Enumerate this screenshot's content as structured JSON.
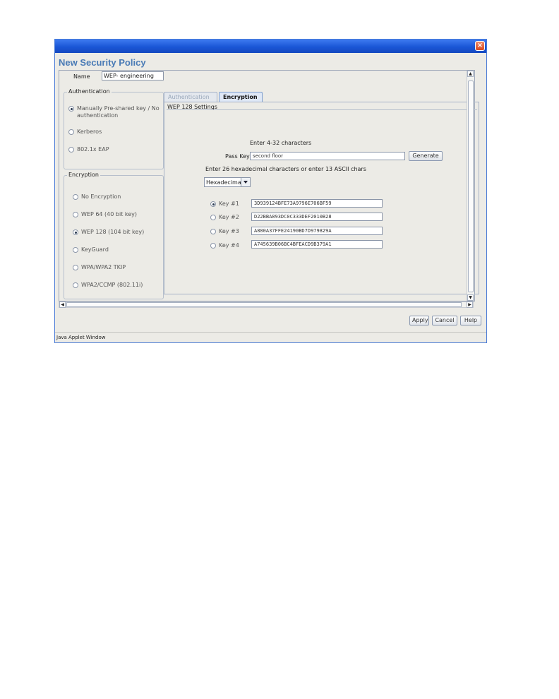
{
  "window": {
    "title": "New Security Policy",
    "status_text": "Java Applet Window"
  },
  "name_field": {
    "label": "Name",
    "value": "WEP- engineering"
  },
  "authentication": {
    "title": "Authentication",
    "options": [
      {
        "label": "Manually Pre-shared key / No authentication",
        "selected": true
      },
      {
        "label": "Kerberos",
        "selected": false
      },
      {
        "label": "802.1x EAP",
        "selected": false
      }
    ]
  },
  "encryption": {
    "title": "Encryption",
    "options": [
      {
        "label": "No Encryption",
        "selected": false
      },
      {
        "label": "WEP 64 (40 bit key)",
        "selected": false
      },
      {
        "label": "WEP 128 (104 bit key)",
        "selected": true
      },
      {
        "label": "KeyGuard",
        "selected": false
      },
      {
        "label": "WPA/WPA2 TKIP",
        "selected": false
      },
      {
        "label": "WPA2/CCMP (802.11i)",
        "selected": false
      }
    ]
  },
  "tabs": [
    {
      "label": "Authentication",
      "active": false
    },
    {
      "label": "Encryption",
      "active": true
    }
  ],
  "wep": {
    "title": "WEP 128 Settings",
    "passkey_hint": "Enter 4-32 characters",
    "passkey_label": "Pass Key",
    "passkey_value": "second floor",
    "generate_label": "Generate",
    "hex_hint": "Enter 26 hexadecimal characters or enter 13 ASCII chars",
    "format_value": "Hexadecimal",
    "keys": [
      {
        "label": "Key #1",
        "value": "3D939124BFE73A9796E706BF59",
        "selected": true
      },
      {
        "label": "Key #2",
        "value": "D22BBA893DC0C333DEF2010B28",
        "selected": false
      },
      {
        "label": "Key #3",
        "value": "A880A37FFE24190BD7D979829A",
        "selected": false
      },
      {
        "label": "Key #4",
        "value": "A745639B06BC4BFEACD9B379A1",
        "selected": false
      }
    ]
  },
  "buttons": {
    "apply": "Apply",
    "cancel": "Cancel",
    "help": "Help"
  },
  "colors": {
    "title_bar": "#1a56d6",
    "page_title": "#4a7bb6",
    "close": "#d64a20"
  }
}
